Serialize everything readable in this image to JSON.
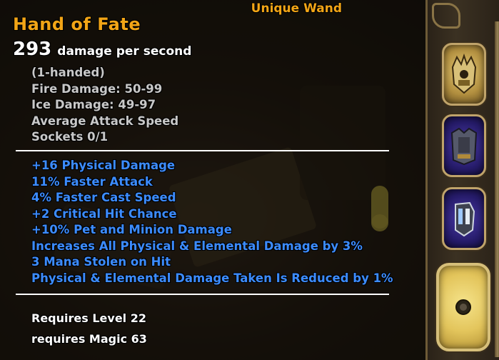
{
  "item": {
    "rarity_label": "Unique Wand",
    "name": "Hand of Fate",
    "dps_value": "293",
    "dps_label": "damage per second",
    "base_stats": [
      "(1-handed)",
      "Fire Damage: 50-99",
      "Ice Damage: 49-97",
      "Average Attack Speed",
      "Sockets 0/1"
    ],
    "affixes": [
      "+16 Physical Damage",
      "11% Faster Attack",
      "4% Faster Cast Speed",
      "+2 Critical Hit Chance",
      "+10% Pet and Minion Damage",
      "Increases All Physical & Elemental Damage by 3%",
      "3 Mana Stolen on Hit",
      "Physical & Elemental Damage Taken Is Reduced by 1%"
    ],
    "requirements": [
      "Requires Level 22",
      "requires Magic 63"
    ]
  },
  "colors": {
    "unique": "#f2a516",
    "base_stat": "#c8c8c8",
    "affix": "#3c8cff",
    "requirement": "#ffffff"
  },
  "equipment_panel": {
    "slots": [
      {
        "icon": "crown-helmet-icon",
        "frame": "gold"
      },
      {
        "icon": "chest-armor-icon",
        "frame": "blue"
      },
      {
        "icon": "gauntlet-icon",
        "frame": "blue"
      },
      {
        "icon": "empty-socket-icon",
        "frame": "selected"
      }
    ]
  }
}
